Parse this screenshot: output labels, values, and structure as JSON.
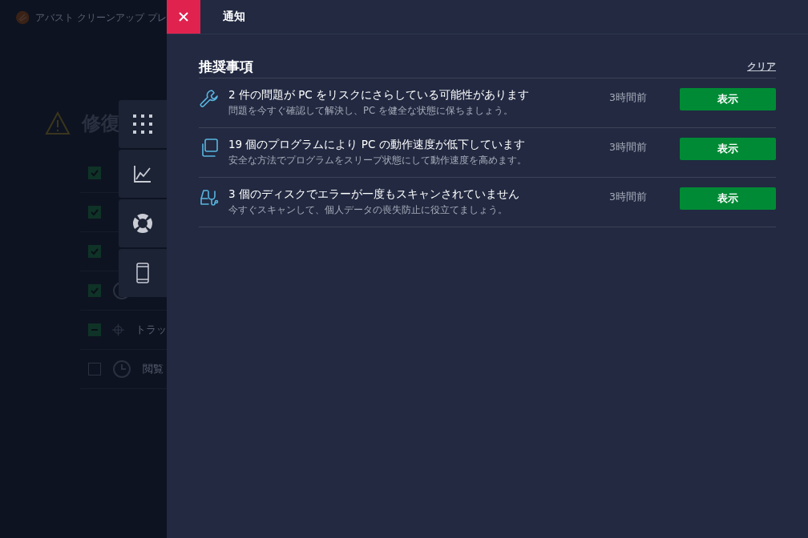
{
  "app": {
    "title": "アバスト クリーンアップ プレ",
    "heading": "修復",
    "rows": [
      {
        "checked": true,
        "mixed": false
      },
      {
        "checked": true,
        "mixed": false
      },
      {
        "checked": true,
        "mixed": false
      },
      {
        "checked": true,
        "mixed": false,
        "kind": "globe"
      },
      {
        "checked": true,
        "mixed": true,
        "kind": "target",
        "label": "トラッ"
      },
      {
        "checked": false,
        "mixed": false,
        "kind": "clock",
        "label": "閲覧"
      }
    ]
  },
  "side_nav": [
    {
      "kind": "grid"
    },
    {
      "kind": "chart"
    },
    {
      "kind": "lifebuoy"
    },
    {
      "kind": "phone"
    }
  ],
  "panel": {
    "title": "通知",
    "section": "推奨事項",
    "clear": "クリア",
    "items": [
      {
        "kind": "wrench",
        "title": "2 件の問題が PC をリスクにさらしている可能性があります",
        "subtitle": "問題を今すぐ確認して解決し、PC を健全な状態に保ちましょう。",
        "time": "3時間前",
        "action": "表示"
      },
      {
        "kind": "windows",
        "title": "19 個のプログラムにより PC の動作速度が低下しています",
        "subtitle": "安全な方法でプログラムをスリープ状態にして動作速度を高めます。",
        "time": "3時間前",
        "action": "表示"
      },
      {
        "kind": "stethoscope",
        "title": "3 個のディスクでエラーが一度もスキャンされていません",
        "subtitle": "今すぐスキャンして、個人データの喪失防止に役立てましょう。",
        "time": "3時間前",
        "action": "表示"
      }
    ]
  }
}
